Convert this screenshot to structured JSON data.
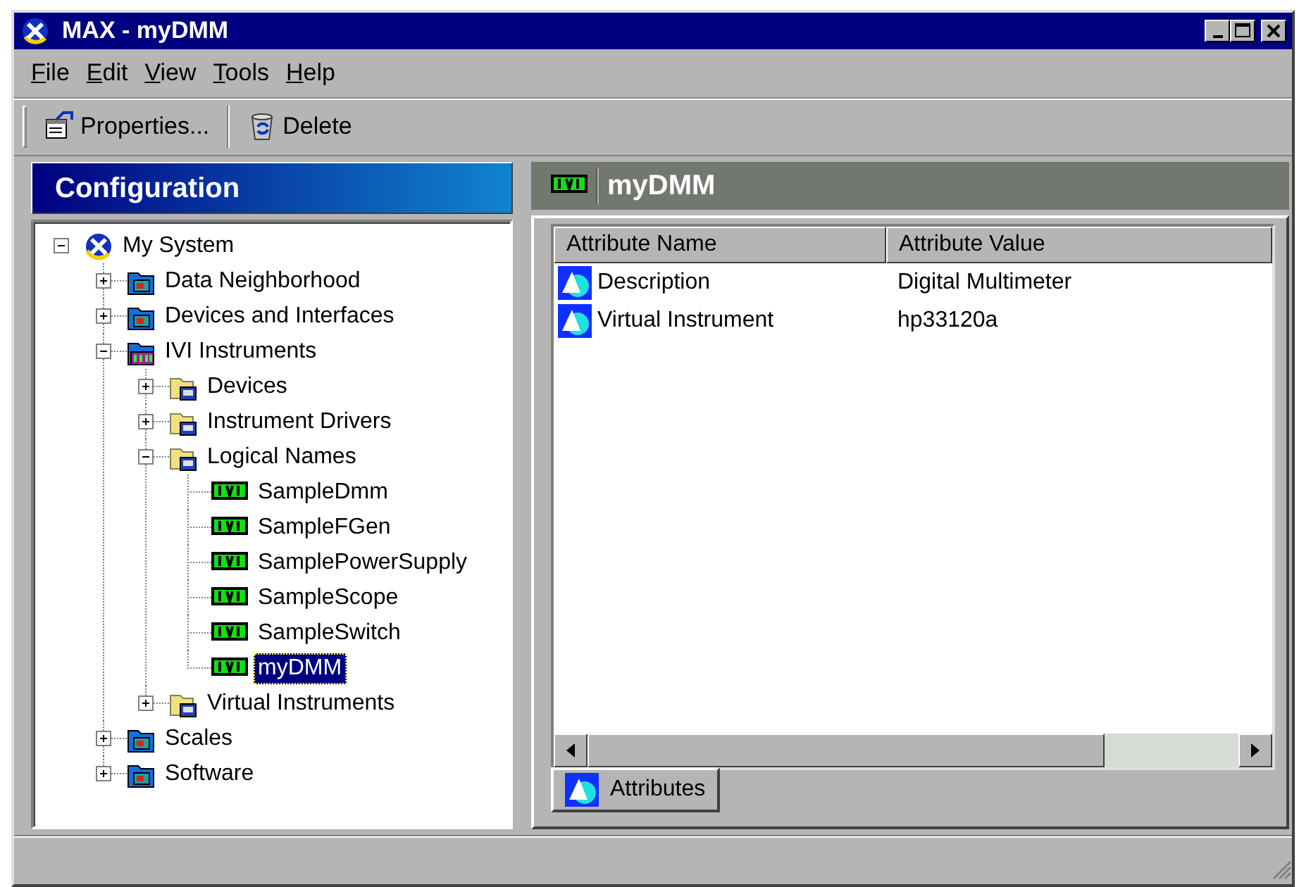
{
  "window": {
    "title": "MAX - myDMM"
  },
  "menu": [
    "File",
    "Edit",
    "View",
    "Tools",
    "Help"
  ],
  "toolbar": [
    {
      "label": "Properties...",
      "kind": "properties"
    },
    {
      "label": "Delete",
      "kind": "delete"
    }
  ],
  "sidebar": {
    "title": "Configuration",
    "tree": [
      {
        "label": "My System",
        "kind": "system",
        "selected": false,
        "expanded": true,
        "children": [
          {
            "label": "Data Neighborhood",
            "kind": "blue-folder",
            "selected": false,
            "expanded": false
          },
          {
            "label": "Devices and Interfaces",
            "kind": "blue-folder",
            "selected": false,
            "expanded": false
          },
          {
            "label": "IVI Instruments",
            "kind": "ivi-folder",
            "selected": false,
            "expanded": true,
            "children": [
              {
                "label": "Devices",
                "kind": "yellow-folder",
                "selected": false,
                "expanded": false
              },
              {
                "label": "Instrument Drivers",
                "kind": "yellow-folder",
                "selected": false,
                "expanded": false
              },
              {
                "label": "Logical Names",
                "kind": "yellow-folder",
                "selected": false,
                "expanded": true,
                "children": [
                  {
                    "label": "SampleDmm",
                    "kind": "ivi",
                    "selected": false
                  },
                  {
                    "label": "SampleFGen",
                    "kind": "ivi",
                    "selected": false
                  },
                  {
                    "label": "SamplePowerSupply",
                    "kind": "ivi",
                    "selected": false
                  },
                  {
                    "label": "SampleScope",
                    "kind": "ivi",
                    "selected": false
                  },
                  {
                    "label": "SampleSwitch",
                    "kind": "ivi",
                    "selected": false
                  },
                  {
                    "label": "myDMM",
                    "kind": "ivi",
                    "selected": true
                  }
                ]
              },
              {
                "label": "Virtual Instruments",
                "kind": "yellow-folder",
                "selected": false,
                "expanded": false
              }
            ]
          },
          {
            "label": "Scales",
            "kind": "blue-folder",
            "selected": false,
            "expanded": false
          },
          {
            "label": "Software",
            "kind": "blue-folder",
            "selected": false,
            "expanded": false
          }
        ]
      }
    ]
  },
  "detail": {
    "title": "myDMM",
    "columns": [
      "Attribute Name",
      "Attribute Value"
    ],
    "rows": [
      [
        "Description",
        "Digital Multimeter"
      ],
      [
        "Virtual Instrument",
        "hp33120a"
      ]
    ],
    "tabs": [
      {
        "label": "Attributes",
        "selected": true
      }
    ]
  }
}
